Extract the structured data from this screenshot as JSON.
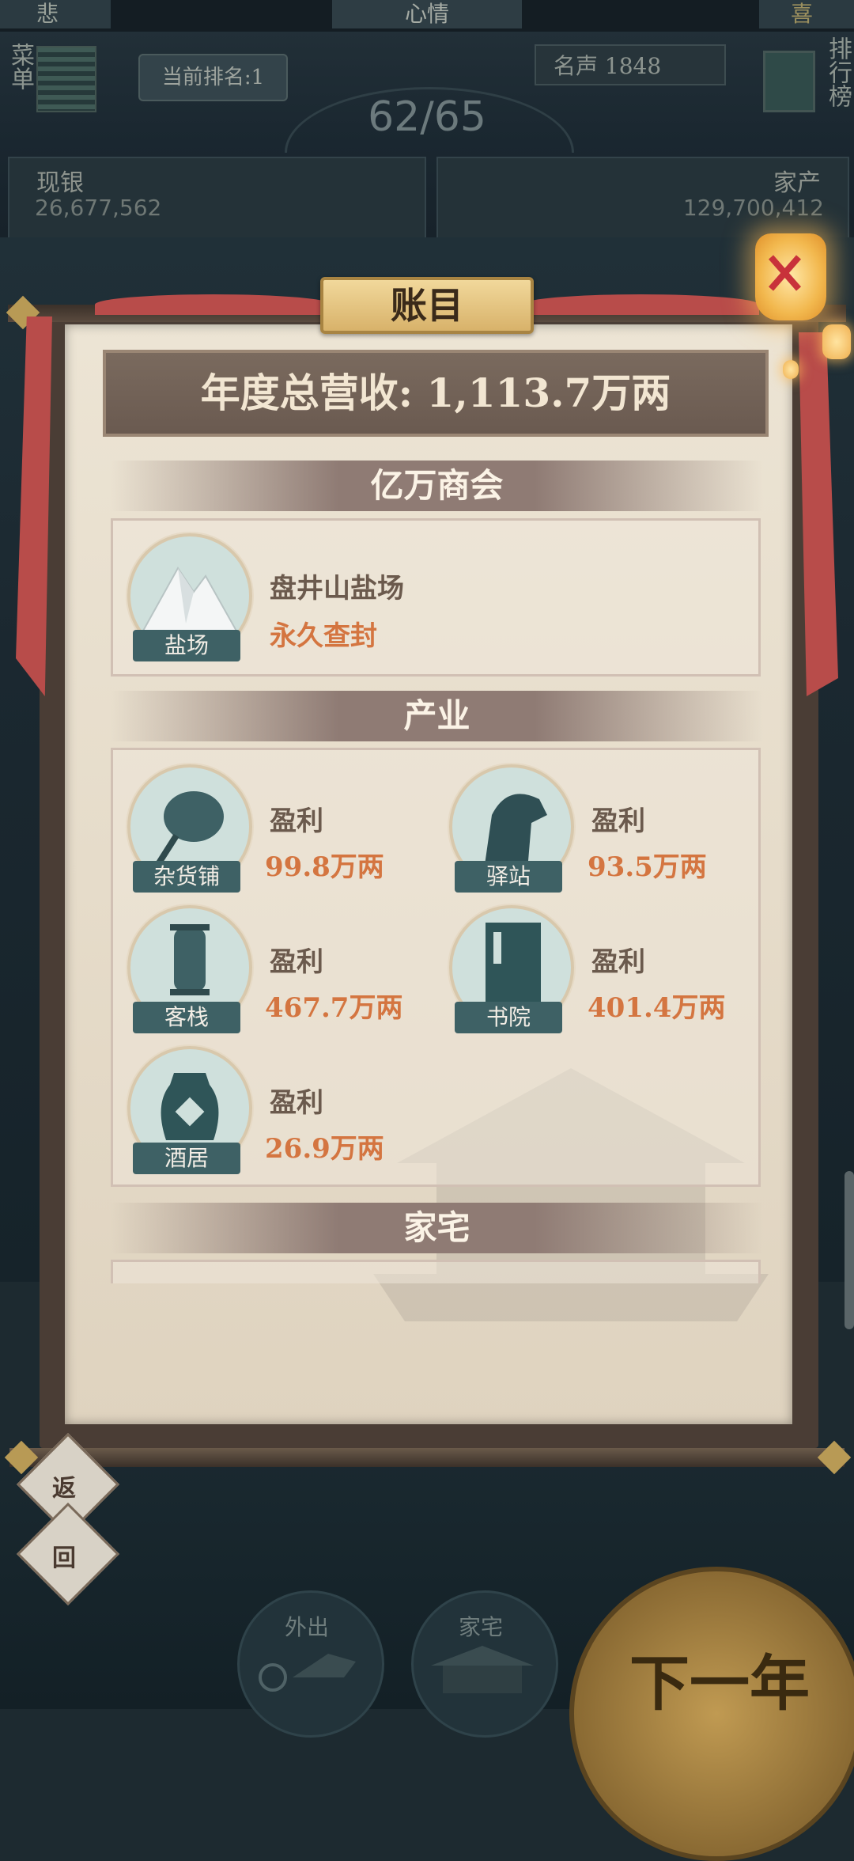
{
  "hud": {
    "mood_left": "悲",
    "mood_center": "心情",
    "mood_right": "喜",
    "menu_label": "菜单",
    "rank_label": "当前排名:1",
    "fame_label": "名声 1848",
    "rankboard_label": "排行榜",
    "progress": "62/65",
    "cash_label": "现银",
    "cash_value": "26,677,562",
    "assets_label": "家产",
    "assets_value": "129,700,412"
  },
  "dialog": {
    "title": "账目",
    "revenue": "年度总营收:  1,113.7万两",
    "sections": {
      "guild": "亿万商会",
      "industry": "产业",
      "home": "家宅"
    },
    "guild_item": {
      "icon_label": "盐场",
      "name": "盘井山盐场",
      "status": "永久查封"
    },
    "industries": [
      {
        "icon_label": "杂货铺",
        "title": "盈利",
        "value": "99.8万两",
        "icon": "fan-icon"
      },
      {
        "icon_label": "驿站",
        "title": "盈利",
        "value": "93.5万两",
        "icon": "horse-icon"
      },
      {
        "icon_label": "客栈",
        "title": "盈利",
        "value": "467.7万两",
        "icon": "lantern-icon"
      },
      {
        "icon_label": "书院",
        "title": "盈利",
        "value": "401.4万两",
        "icon": "book-icon"
      },
      {
        "icon_label": "酒居",
        "title": "盈利",
        "value": "26.9万两",
        "icon": "wine-jar-icon"
      }
    ]
  },
  "bottom": {
    "back_1": "返",
    "back_2": "回",
    "outing": "外出",
    "home": "家宅",
    "next_year": "下一年"
  },
  "colors": {
    "paper": "#e6dcca",
    "accent_orange": "#d47540",
    "teal_label": "#3e6165",
    "ribbon_red": "#b84c4a",
    "title_gold": "#d8b26a"
  }
}
